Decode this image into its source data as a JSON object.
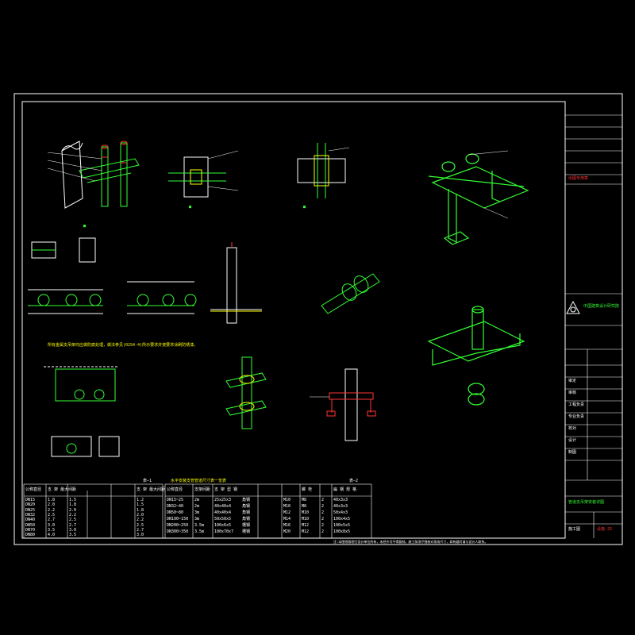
{
  "colors": {
    "background": "#000000",
    "frame": "#ffffff",
    "geometry": "#33ff33",
    "dim": "#00ffff",
    "text": "#ffffff",
    "accent": "#ff3333",
    "yellow": "#ffff00",
    "magenta": "#ff33ff"
  },
  "table1": {
    "number": "表—1",
    "header": [
      "公称直径",
      "支 架 最大间距",
      "",
      "",
      "",
      "支 架 最大间距"
    ],
    "rows": [
      [
        "DN15",
        "1.8",
        "1.5",
        "",
        "",
        "1.2"
      ],
      [
        "DN20",
        "2.0",
        "1.8",
        "",
        "",
        "1.5"
      ],
      [
        "DN25",
        "2.2",
        "2.0",
        "",
        "",
        "1.8"
      ],
      [
        "DN32",
        "2.5",
        "2.2",
        "",
        "",
        "2.0"
      ],
      [
        "DN40",
        "2.7",
        "2.5",
        "",
        "",
        "2.2"
      ],
      [
        "DN50",
        "3.0",
        "2.7",
        "",
        "",
        "2.5"
      ],
      [
        "DN70",
        "3.5",
        "3.0",
        "",
        "",
        "2.7"
      ],
      [
        "DN80",
        "4.0",
        "3.5",
        "",
        "",
        "3.0"
      ]
    ]
  },
  "table2": {
    "number": "表—2",
    "title": "水平安装支管管道尺寸表一览表",
    "header": [
      "公称直径",
      "支架间距",
      "支 架 型 钢",
      "",
      "",
      "",
      "螺 栓",
      "",
      "扁 钢 规 格"
    ],
    "rows": [
      [
        "DN15~25",
        "2m",
        "25x25x3",
        "角钢",
        "",
        "M10",
        "M8",
        "2",
        "40x3x3"
      ],
      [
        "DN32~40",
        "2m",
        "40x40x4",
        "角钢",
        "",
        "M10",
        "M8",
        "2",
        "40x3x3"
      ],
      [
        "DN50~80",
        "3m",
        "40x40x4",
        "角钢",
        "",
        "M12",
        "M10",
        "2",
        "50x4x3"
      ],
      [
        "DN100~150",
        "3m",
        "50x50x5",
        "角钢",
        "",
        "M14",
        "M10",
        "2",
        "100x4x5"
      ],
      [
        "DN200~250",
        "3.5m",
        "100x6x5",
        "槽钢",
        "",
        "M16",
        "M12",
        "2",
        "100x5x5"
      ],
      [
        "DN300~350",
        "3.5m",
        "100x70x7",
        "槽钢",
        "",
        "M20",
        "M12",
        "2",
        "100x8x5"
      ]
    ]
  },
  "note_line": "所有金属支吊架均应做防腐处理，做法参见(02S4-4)所示要求并按要求涂刷防锈漆。",
  "title_block": {
    "company": "中国建筑设计研究院",
    "stamp_text": "出图专用章",
    "rows": [
      "审定",
      "审核",
      "工程负责",
      "专业负责",
      "校对",
      "设计",
      "制图"
    ],
    "drawing_title": "管道支吊架安装详图",
    "sheet_no": "设施-25",
    "stage": "施工图"
  },
  "footer_note": "注:本图纸版权归设计单位所有，未经许可不得复制。施工前须仔细核对现场尺寸，如有疑问请与设计人联系。"
}
